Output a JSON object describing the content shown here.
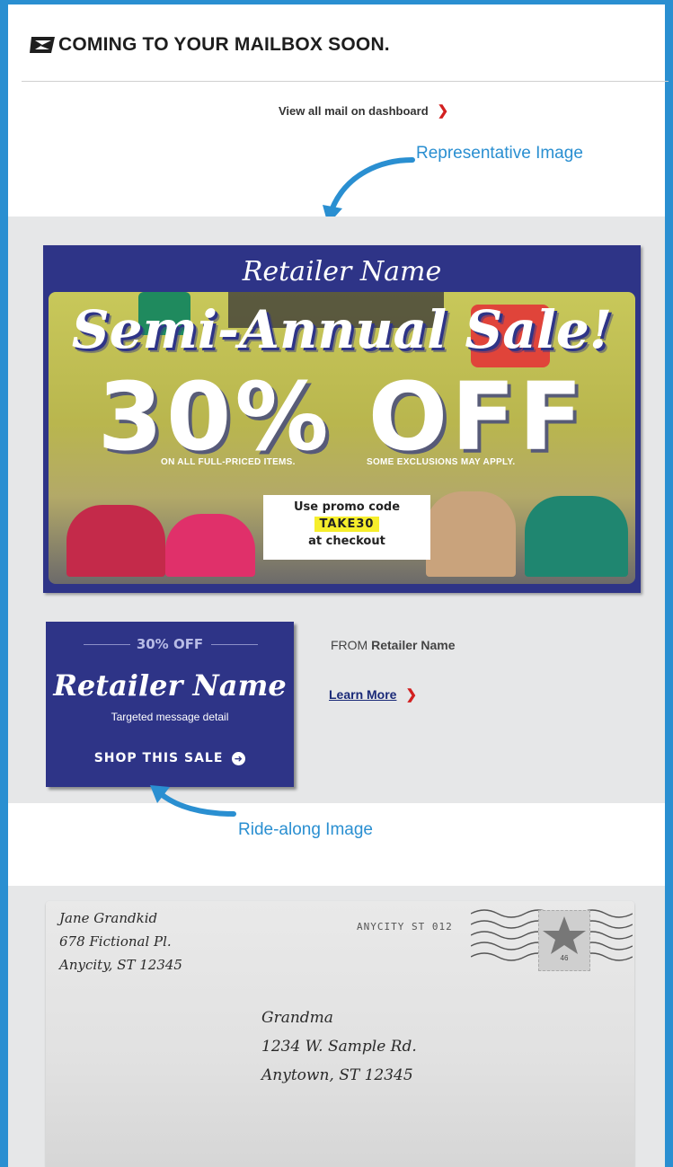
{
  "header": {
    "title": "COMING TO YOUR MAILBOX SOON.",
    "logo_icon": "eagle-logo-icon"
  },
  "dashboard_link": {
    "label": "View all mail on dashboard",
    "icon": "chevron-right-icon"
  },
  "callouts": {
    "representative": "Representative Image",
    "ride_along": "Ride-along Image"
  },
  "hero": {
    "brand": "Retailer Name",
    "headline": "Semi-Annual Sale!",
    "discount": "30% OFF",
    "fine_left": "ON ALL FULL-PRICED ITEMS.",
    "fine_right": "SOME EXCLUSIONS MAY APPLY.",
    "promo_line1": "Use promo code",
    "promo_code": "TAKE30",
    "promo_line3": "at checkout"
  },
  "ride_along": {
    "percent": "30% OFF",
    "brand": "Retailer Name",
    "detail": "Targeted message detail",
    "cta": "SHOP THIS SALE"
  },
  "from": {
    "prefix": "FROM",
    "name": "Retailer Name"
  },
  "learn_more": {
    "label": "Learn More"
  },
  "envelope": {
    "return_address": [
      "Jane Grandkid",
      "678 Fictional Pl.",
      "Anycity, ST 12345"
    ],
    "postmark": "ANYCITY ST 012",
    "stamp_value": "46",
    "recipient": [
      "Grandma",
      "1234 W. Sample Rd.",
      "Anytown, ST 12345"
    ]
  },
  "colors": {
    "frame": "#2a8fd1",
    "brand_navy": "#2e3487",
    "promo_yellow": "#f6ee2c",
    "link_red": "#d22020",
    "band_gray": "#e6e7e8"
  }
}
